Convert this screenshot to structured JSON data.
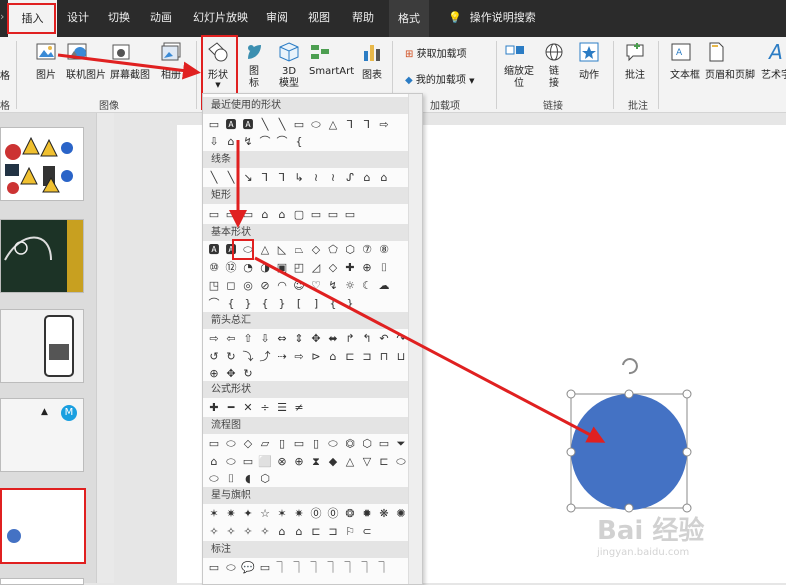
{
  "tabs": [
    {
      "label": "插入",
      "active": true
    },
    {
      "label": "设计"
    },
    {
      "label": "切换"
    },
    {
      "label": "动画"
    },
    {
      "label": "幻灯片放映"
    },
    {
      "label": "审阅"
    },
    {
      "label": "视图"
    },
    {
      "label": "帮助"
    },
    {
      "label": "格式",
      "contextual": true
    }
  ],
  "tell_me": "操作说明搜索",
  "ribbon": {
    "buttons": {
      "table": "格",
      "picture": "图片",
      "online_picture": "联机图片",
      "screenshot": "屏幕截图",
      "album": "相册",
      "shapes": "形状",
      "icons1": "图",
      "icons2": "标",
      "model1": "3D",
      "model2": "模型",
      "smartart": "SmartArt",
      "chart": "图表",
      "get_addins": "获取加载项",
      "my_addins": "我的加载项",
      "zoom1": "缩放定",
      "zoom2": "位",
      "link1": "链",
      "link2": "接",
      "action": "动作",
      "comment": "批注",
      "textbox": "文本框",
      "header_footer": "页眉和页脚",
      "wordart": "艺术字"
    },
    "groups": {
      "table": "格",
      "images": "图像",
      "addins": "加载项",
      "links": "链接",
      "comments": "批注"
    }
  },
  "shapes_menu": {
    "sections": {
      "recent": "最近使用的形状",
      "lines": "线条",
      "rect": "矩形",
      "basic": "基本形状",
      "arrows": "箭头总汇",
      "equation": "公式形状",
      "flowchart": "流程图",
      "stars": "星与旗帜",
      "callouts": "标注"
    },
    "rows": {
      "recent1": [
        "▭",
        "🅰",
        "🅰",
        "╲",
        "╲",
        "▭",
        "⬭",
        "△",
        "⅂",
        "⅂",
        "⇨"
      ],
      "recent2": [
        "⇩",
        "⌂",
        "↯",
        "⌒",
        "⌒",
        "{"
      ],
      "lines": [
        "╲",
        "╲",
        "↘",
        "⅂",
        "⅂",
        "↳",
        "≀",
        "≀",
        "ᔑ",
        "⌂",
        "⌂"
      ],
      "rect": [
        "▭",
        "▭",
        "▭",
        "⌂",
        "⌂",
        "▢",
        "▭",
        "▭",
        "▭"
      ],
      "basic1": [
        "🅰",
        "🅰",
        "⬭",
        "△",
        "◺",
        "⏢",
        "◇",
        "⬠",
        "⬡",
        "⑦",
        "⑧"
      ],
      "basic2": [
        "⑩",
        "⑫",
        "◔",
        "◑",
        "▣",
        "◰",
        "◿",
        "◇",
        "✚",
        "⊕",
        "⌷"
      ],
      "basic3": [
        "◳",
        "◻",
        "◎",
        "⊘",
        "◠",
        "☺",
        "♡",
        "↯",
        "☼",
        "☾",
        "☁"
      ],
      "basic4": [
        "⌒",
        "{",
        "}",
        "{",
        "}",
        "[",
        "]",
        "{",
        "}"
      ],
      "arrows1": [
        "⇨",
        "⇦",
        "⇧",
        "⇩",
        "⇔",
        "⇕",
        "✥",
        "⬌",
        "↱",
        "↰",
        "↶",
        "↷"
      ],
      "arrows2": [
        "↺",
        "↻",
        "⤵",
        "⤴",
        "⇢",
        "⇨",
        "⊳",
        "⌂",
        "⊏",
        "⊐",
        "⊓",
        "⊔"
      ],
      "arrows3": [
        "⊕",
        "✥",
        "↻"
      ],
      "equation": [
        "✚",
        "━",
        "✕",
        "÷",
        "☰",
        "≠"
      ],
      "flow1": [
        "▭",
        "⬭",
        "◇",
        "▱",
        "▯",
        "▭",
        "▯",
        "⬭",
        "⏣",
        "⬡",
        "▭",
        "⏷"
      ],
      "flow2": [
        "⌂",
        "⬭",
        "▭",
        "⬜",
        "⊗",
        "⊕",
        "⧗",
        "◆",
        "△",
        "▽",
        "⊏",
        "⬭"
      ],
      "flow3": [
        "⬭",
        "⌷",
        "◖",
        "⬡"
      ],
      "stars1": [
        "✶",
        "✷",
        "✦",
        "☆",
        "✶",
        "✷",
        "⓪",
        "⓪",
        "❂",
        "✹",
        "❋",
        "✺"
      ],
      "stars2": [
        "✧",
        "✧",
        "✧",
        "✧",
        "⌂",
        "⌂",
        "⊏",
        "⊐",
        "⚐",
        "⊂"
      ],
      "callouts": [
        "▭",
        "⬭",
        "💬",
        "▭",
        "⏋",
        "⏋",
        "⏋",
        "⏋",
        "⏋",
        "⏋",
        "⏋"
      ]
    }
  },
  "thumbnails": [
    "slide-1",
    "slide-2",
    "slide-3",
    "slide-4",
    "slide-5"
  ],
  "thumb4_badge": "M",
  "shape_color": "#4472c4",
  "accent_red": "#e02020",
  "watermark": {
    "text": "Bai 经验",
    "url": "jingyan.baidu.com"
  }
}
